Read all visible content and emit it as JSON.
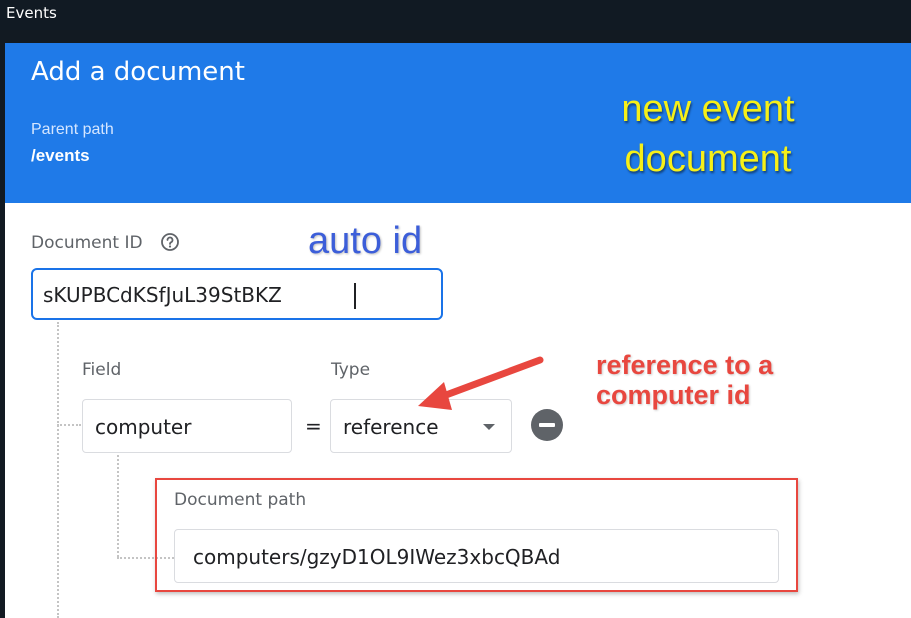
{
  "window": {
    "title": "Events"
  },
  "dialog": {
    "title": "Add a document",
    "parent_path_label": "Parent path",
    "parent_path_value": "/events"
  },
  "document_id": {
    "label": "Document ID",
    "value": "sKUPBCdKSfJuL39StBKZ"
  },
  "field_row": {
    "field_label": "Field",
    "type_label": "Type",
    "field_value": "computer",
    "equals": "=",
    "type_value": "reference"
  },
  "document_path": {
    "label": "Document path",
    "value": "computers/gzyD1OL9IWez3xbcQBAd"
  },
  "annotations": {
    "new_event_lines": [
      "new event",
      "document"
    ],
    "auto_id": "auto id",
    "reference_lines": [
      "reference to a",
      "computer id"
    ]
  },
  "colors": {
    "header": "#1f7ae8",
    "annotation_yellow": "#f6f018",
    "annotation_blue": "#3c5ed9",
    "annotation_red": "#e8473f"
  },
  "icons": {
    "help": "help-circle-icon",
    "remove": "remove-circle-icon",
    "dropdown": "chevron-down-icon"
  }
}
